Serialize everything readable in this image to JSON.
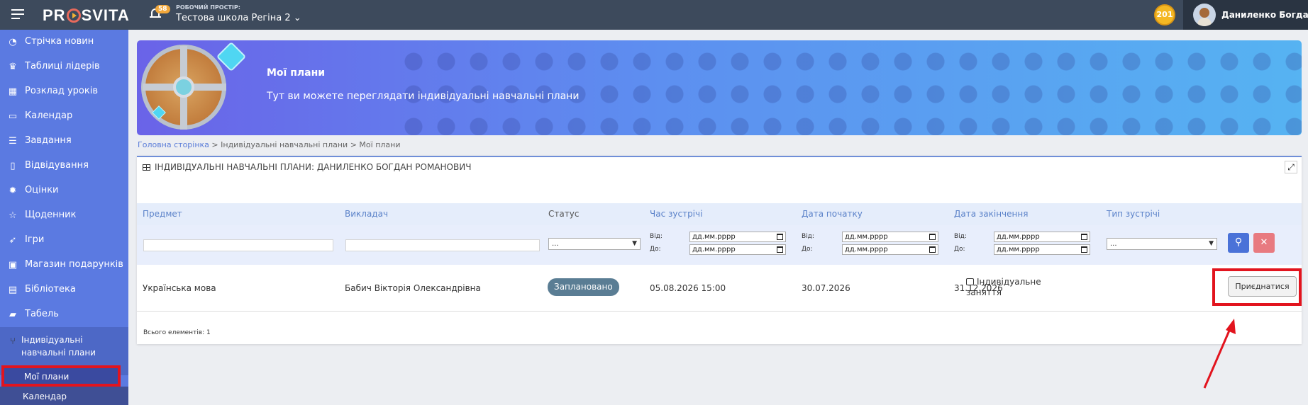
{
  "topbar": {
    "logo": "PROSVITA",
    "notifications_count": "58",
    "workspace_label": "РОБОЧИЙ ПРОСТІР:",
    "workspace_name": "Тестова школа Регіна 2",
    "coins": "201",
    "user_name": "Даниленко Богдан"
  },
  "sidebar": {
    "items": [
      {
        "label": "Стрічка новин",
        "icon": "rss-icon"
      },
      {
        "label": "Таблиці лідерів",
        "icon": "trophy-icon"
      },
      {
        "label": "Розклад уроків",
        "icon": "schedule-icon"
      },
      {
        "label": "Календар",
        "icon": "calendar-icon"
      },
      {
        "label": "Завдання",
        "icon": "tasks-icon"
      },
      {
        "label": "Відвідування",
        "icon": "document-icon"
      },
      {
        "label": "Оцінки",
        "icon": "gear-icon"
      },
      {
        "label": "Щоденник",
        "icon": "star-icon"
      },
      {
        "label": "Ігри",
        "icon": "rocket-icon"
      },
      {
        "label": "Магазин подарунків",
        "icon": "gift-icon"
      },
      {
        "label": "Бібліотека",
        "icon": "book-icon"
      },
      {
        "label": "Табель",
        "icon": "folder-icon"
      }
    ],
    "group": {
      "label_line1": "Індивідуальні",
      "label_line2": "навчальні плани",
      "icon": "branch-icon"
    },
    "subitems": [
      {
        "label": "Мої плани"
      },
      {
        "label": "Календар"
      }
    ]
  },
  "banner": {
    "title": "Мої плани",
    "subtitle": "Тут ви можете переглядати індивідуальні навчальні плани"
  },
  "breadcrumb": {
    "home": "Головна сторінка",
    "sep1": " > ",
    "section": "Індивідуальні навчальні плани",
    "sep2": " > ",
    "current": "Мої плани"
  },
  "panel": {
    "title": "ІНДИВІДУАЛЬНІ НАВЧАЛЬНІ ПЛАНИ: ДАНИЛЕНКО БОГДАН РОМАНОВИЧ",
    "columns": [
      "Предмет",
      "Викладач",
      "Статус",
      "Час зустрічі",
      "Дата початку",
      "Дата закінчення",
      "Тип зустрічі"
    ],
    "filters": {
      "select_placeholder": "...",
      "from_label": "Від:",
      "to_label": "До:",
      "date_placeholder": "дд.мм.рррр"
    },
    "rows": [
      {
        "subject": "Українська мова",
        "teacher": "Бабич Вікторія Олександрівна",
        "status": "Заплановано",
        "meeting_time": "05.08.2026 15:00",
        "start_date": "30.07.2026",
        "end_date": "31.12.2026",
        "meeting_type_line1": "Індивідуальне",
        "meeting_type_line2": "заняття",
        "action": "Приєднатися"
      }
    ],
    "footer": "Всього елементів: 1"
  },
  "colors": {
    "sidebar": "#5b7ae1",
    "topbar": "#3d4a5c",
    "status_badge": "#5a7d94",
    "highlight": "#e2141e"
  }
}
